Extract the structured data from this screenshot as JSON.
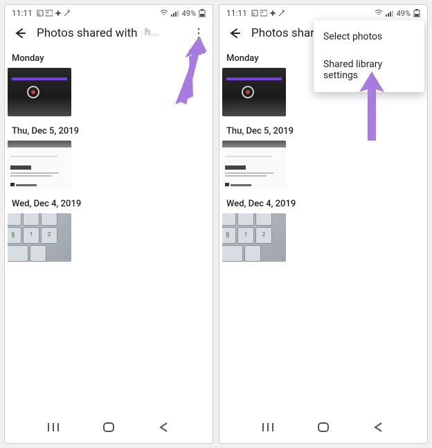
{
  "status": {
    "time": "11:11",
    "left_icons": [
      "speed-icon",
      "picture-icon",
      "pinwheel-icon",
      "wand-icon"
    ],
    "signal_icon": "wifi-icon",
    "bars_icon": "cell-bars-icon",
    "battery_text": "49%",
    "battery_icon": "battery-icon"
  },
  "screen1": {
    "header_title": "Photos shared with meh",
    "header_blur_text": "h...",
    "more_icon": "⋮",
    "groups": [
      {
        "date": "Monday",
        "thumb_kind": "laptop"
      },
      {
        "date": "Thu, Dec 5, 2019",
        "thumb_kind": "settings"
      },
      {
        "date": "Wed, Dec 4, 2019",
        "thumb_kind": "keyboard"
      }
    ],
    "arrow_color": "#a87be0"
  },
  "screen2": {
    "header_title": "Photos share",
    "dropdown": {
      "item1": "Select photos",
      "item2": "Shared library settings"
    },
    "groups": [
      {
        "date": "Monday",
        "thumb_kind": "laptop"
      },
      {
        "date": "Thu, Dec 5, 2019",
        "thumb_kind": "settings"
      },
      {
        "date": "Wed, Dec 4, 2019",
        "thumb_kind": "keyboard"
      }
    ],
    "arrow_color": "#a87be0"
  },
  "nav": {
    "recents": "|||",
    "home": "home-outline",
    "back": "back-chevron"
  }
}
